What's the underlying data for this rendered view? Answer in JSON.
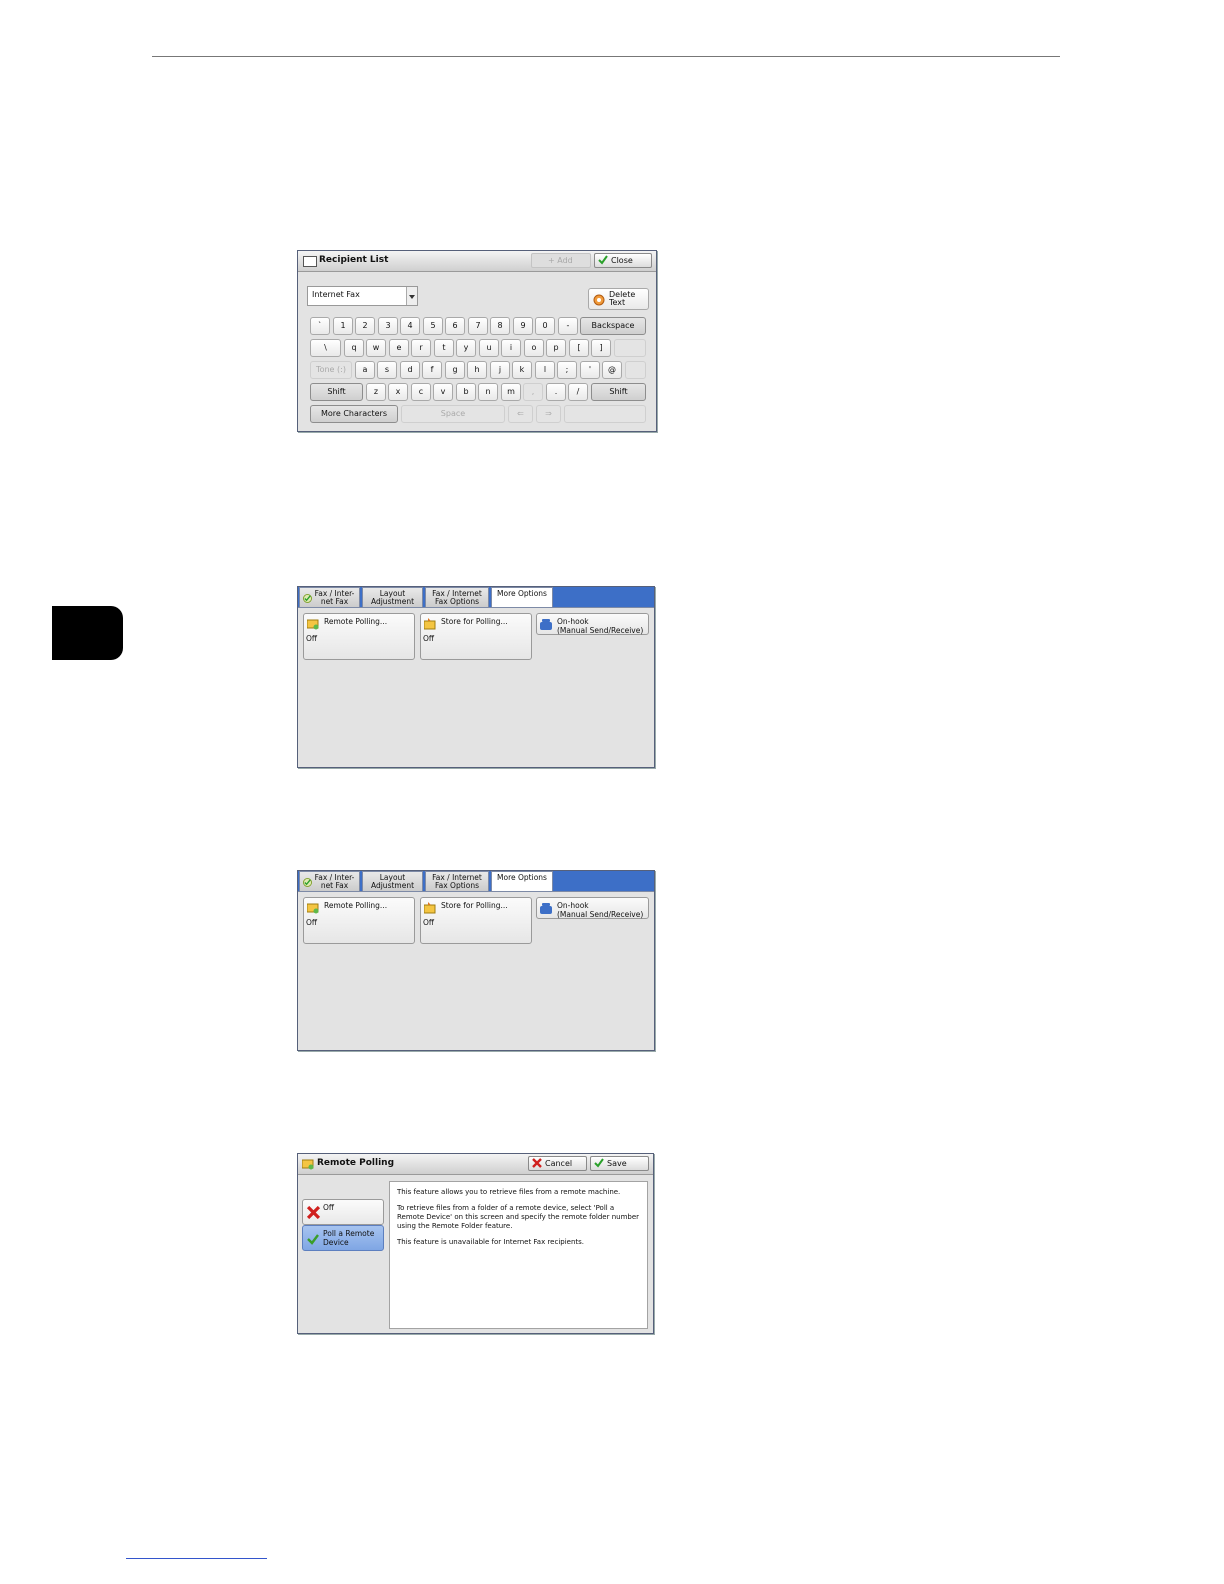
{
  "screen1": {
    "title": "Recipient List",
    "add_button": "+ Add",
    "close_button": "Close",
    "dropdown_value": "Internet Fax",
    "delete_text_button": "Delete Text",
    "row1": [
      "`",
      "1",
      "2",
      "3",
      "4",
      "5",
      "6",
      "7",
      "8",
      "9",
      "0",
      "-"
    ],
    "backspace": "Backspace",
    "row2": [
      "\\",
      "q",
      "w",
      "e",
      "r",
      "t",
      "y",
      "u",
      "i",
      "o",
      "p",
      "[",
      "]"
    ],
    "tone": "Tone (:)",
    "row3": [
      "a",
      "s",
      "d",
      "f",
      "g",
      "h",
      "j",
      "k",
      "l",
      ";",
      "'",
      "@"
    ],
    "shift": "Shift",
    "row4": [
      "z",
      "x",
      "c",
      "v",
      "b",
      "n",
      "m",
      ",",
      ".",
      "/"
    ],
    "more_characters": "More Characters",
    "space": "Space"
  },
  "screen2": {
    "tabs": [
      "Fax / Inter-\nnet Fax",
      "Layout\nAdjustment",
      "Fax / Internet\nFax Options",
      "More Options"
    ],
    "remote_polling": "Remote Polling...",
    "remote_polling_value": "Off",
    "store_for_polling": "Store for Polling...",
    "store_for_polling_value": "Off",
    "on_hook": "On-hook\n(Manual Send/Receive)"
  },
  "screen3": {
    "tabs": [
      "Fax / Inter-\nnet Fax",
      "Layout\nAdjustment",
      "Fax / Internet\nFax Options",
      "More Options"
    ],
    "remote_polling": "Remote Polling...",
    "remote_polling_value": "Off",
    "store_for_polling": "Store for Polling...",
    "store_for_polling_value": "Off",
    "on_hook": "On-hook\n(Manual Send/Receive)"
  },
  "screen4": {
    "title": "Remote Polling",
    "cancel_button": "Cancel",
    "save_button": "Save",
    "option_off": "Off",
    "option_poll": "Poll a Remote\nDevice",
    "desc1": "This feature allows you to retrieve files from a remote machine.",
    "desc2": "To retrieve files from a folder of a remote device, select 'Poll a Remote Device' on this screen and specify the remote folder number using the Remote Folder feature.",
    "desc3": "This feature is unavailable for Internet Fax recipients."
  }
}
